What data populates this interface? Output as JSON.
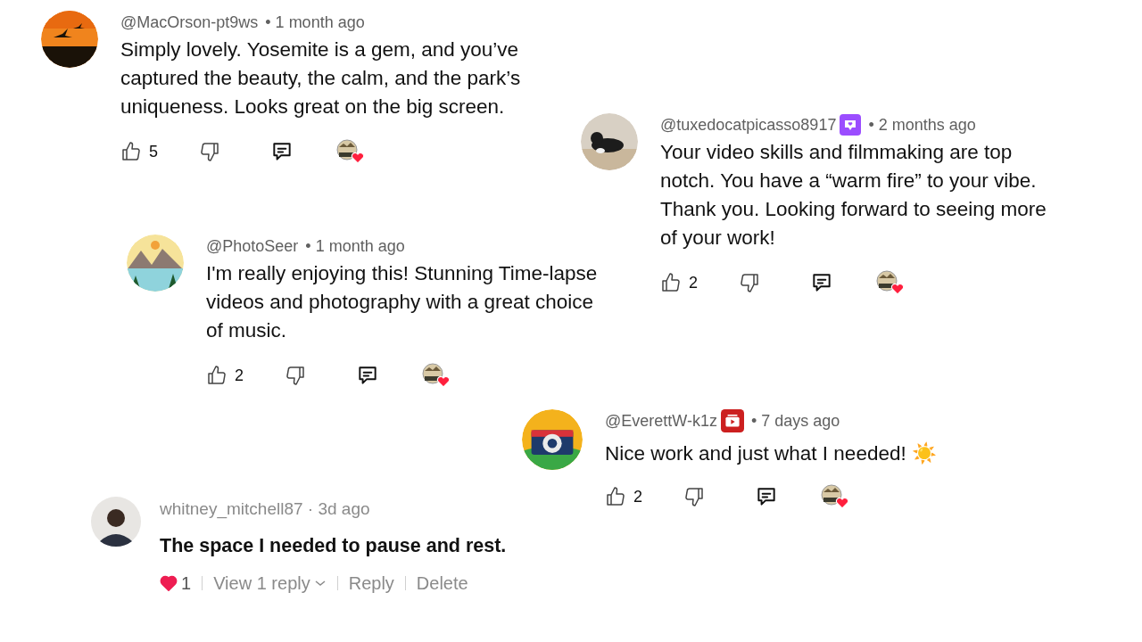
{
  "comments": [
    {
      "kind": "youtube",
      "author": "@MacOrson-pt9ws",
      "time": "• 1 month ago",
      "text": "Simply lovely. Yosemite is a gem, and you’ve captured the beauty, the calm, and the park’s uniqueness. Looks great on the big screen.",
      "likes": "5",
      "creator_heart": true
    },
    {
      "kind": "youtube",
      "author": "@tuxedocatpicasso8917",
      "badge": {
        "kind": "member"
      },
      "time": "• 2 months ago",
      "text": "Your video skills and filmmaking are top notch. You have a “warm fire” to your vibe. Thank you. Looking forward to seeing more of your work!",
      "likes": "2",
      "creator_heart": true
    },
    {
      "kind": "youtube",
      "author": "@PhotoSeer",
      "time": "• 1 month ago",
      "text": "I'm really enjoying this! Stunning Time-lapse videos and photography with a great choice of music.",
      "likes": "2",
      "creator_heart": true
    },
    {
      "kind": "youtube",
      "author": "@EverettW-k1z",
      "badge": {
        "kind": "video"
      },
      "time": "• 7 days ago",
      "text": "Nice work and just what I needed! ☀️",
      "likes": "2",
      "creator_heart": true
    },
    {
      "kind": "tiktok",
      "author": "whitney_mitchell87",
      "time": "· 3d ago",
      "text": "The space I needed to pause and rest.",
      "likes": "1",
      "liked": true,
      "actions": [
        "View 1 reply",
        "Reply",
        "Delete"
      ]
    }
  ]
}
